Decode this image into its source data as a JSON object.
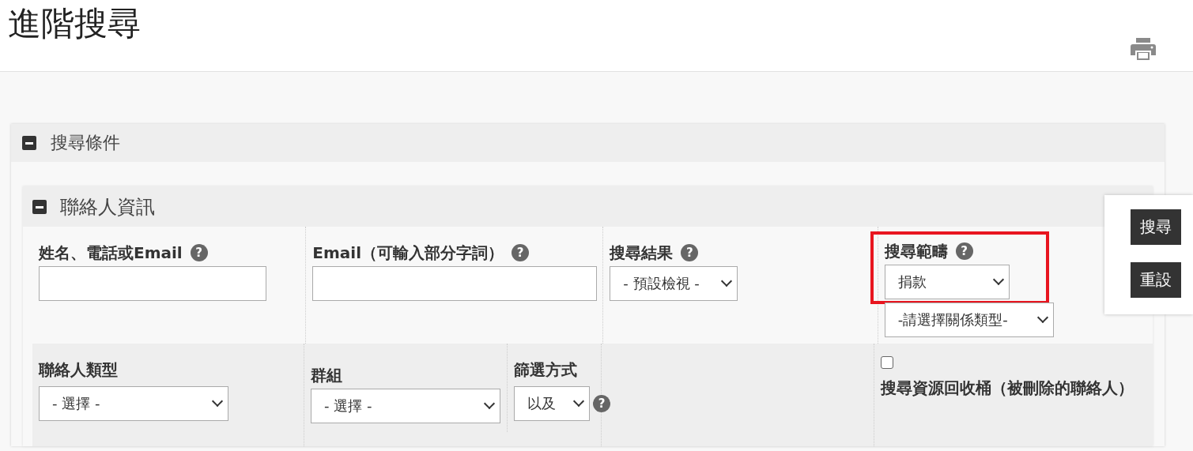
{
  "page_title": "進階搜尋",
  "panel": {
    "title": "搜尋條件",
    "expanded": true,
    "section": {
      "title": "聯絡人資訊",
      "expanded": true,
      "row_1": [
        {
          "kind": "text",
          "label": "姓名、電話或Email",
          "help": "?"
        },
        {
          "kind": "text",
          "label": "Email（可輸入部分字詞）",
          "help": "?"
        },
        {
          "kind": "select",
          "label": "搜尋結果",
          "help": "?",
          "value": "- 預設檢視 -"
        },
        {
          "kind": "select",
          "label": "搜尋範疇",
          "help": "?",
          "value": "捐款",
          "highlighted": true,
          "extra_value": "-請選擇關係類型-"
        }
      ],
      "row_2": [
        {
          "kind": "select",
          "label": "聯絡人類型",
          "value": "- 選擇 -"
        },
        {
          "kind": "group",
          "label": "群組",
          "value": "- 選擇 -",
          "filter_label": "篩選方式",
          "filter_value": "以及",
          "help": "?"
        },
        {
          "kind": "empty"
        },
        {
          "kind": "checkbox",
          "label": "搜尋資源回收桶（被刪除的聯絡人）",
          "checked": false
        }
      ]
    }
  },
  "actions": [
    "搜尋",
    "重設"
  ]
}
